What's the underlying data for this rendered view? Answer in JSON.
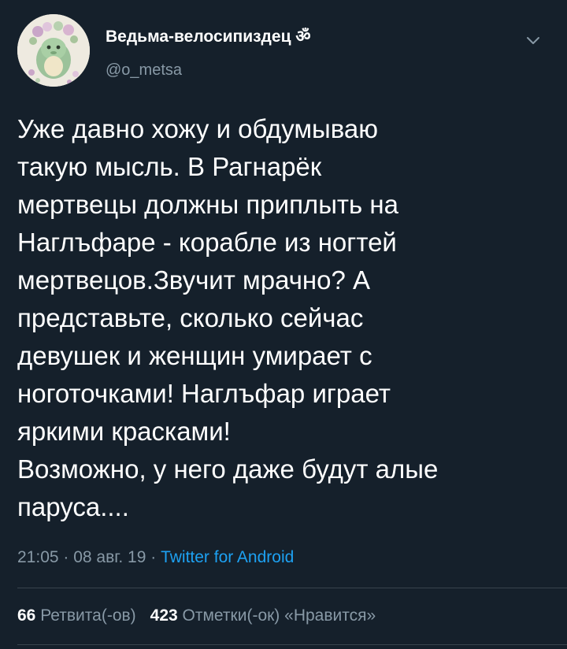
{
  "tweet": {
    "author": {
      "display_name": "Ведьма-велосипиздец ॐ",
      "handle": "@o_metsa",
      "avatar_icon": "avatar-dinosaur-flower-crown"
    },
    "menu_icon": "chevron-down-icon",
    "text": "Уже давно хожу и обдумываю\nтакую мысль. В Рагнарёк\nмертвецы должны приплыть на\nНаглъфаре - корабле из ногтей\nмертвецов.Звучит мрачно? А\nпредставьте, сколько сейчас\nдевушек и женщин умирает с\nноготочками! Наглъфар играет\nяркими красками!\nВозможно, у него даже будут алые\nпаруса....",
    "time": "21:05",
    "date": "08 авг. 19",
    "separator": " · ",
    "source": "Twitter for Android",
    "retweets_count": "66",
    "retweets_label": "Ретвита(-ов)",
    "likes_count": "423",
    "likes_label": "Отметки(-ок) «Нравится»"
  },
  "colors": {
    "background": "#15202b",
    "text": "#ffffff",
    "secondary": "#8899a6",
    "link": "#1da1f2",
    "divider": "#38444d"
  }
}
